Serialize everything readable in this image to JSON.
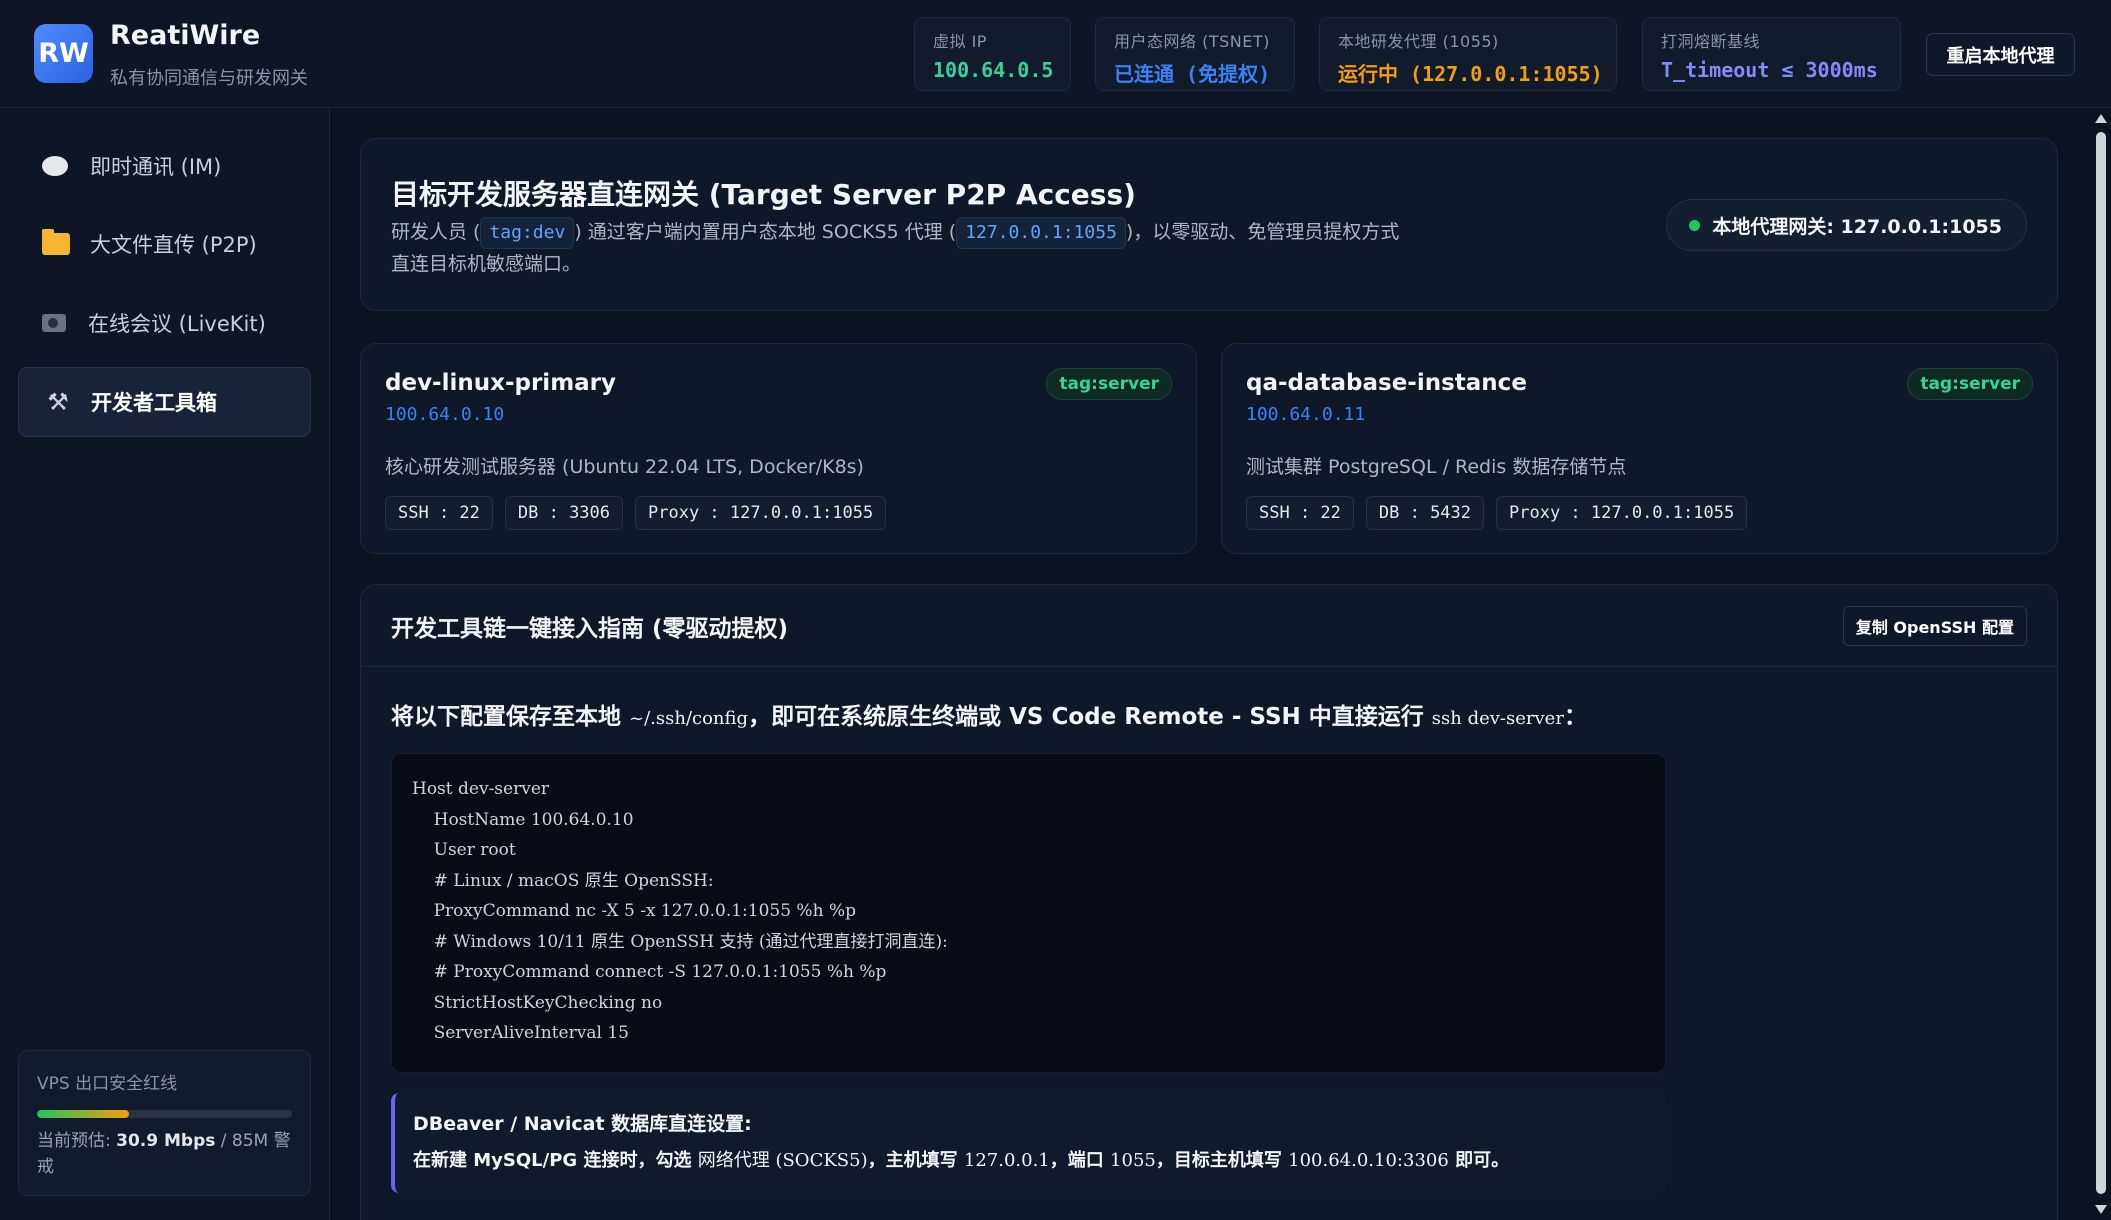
{
  "app": {
    "logo": "RW",
    "name": "ReatiWire",
    "subtitle": "私有协同通信与研发网关"
  },
  "header": {
    "stats": [
      {
        "label": "虚拟 IP",
        "value": "100.64.0.5",
        "color": "#34d399"
      },
      {
        "label": "用户态网络 (TSNET)",
        "value": "已连通 (免提权)",
        "color": "#3b82f6"
      },
      {
        "label": "本地研发代理 (1055)",
        "value": "运行中 (127.0.0.1:1055)",
        "color": "#f59e0b"
      },
      {
        "label": "打洞熔断基线",
        "value": "T_timeout ≤ 3000ms",
        "color": "#818cf8"
      }
    ],
    "restart_label": "重启本地代理"
  },
  "sidebar": {
    "items": [
      {
        "label": "即时通讯 (IM)",
        "icon": "chat-bubble-icon"
      },
      {
        "label": "大文件直传 (P2P)",
        "icon": "folder-icon"
      },
      {
        "label": "在线会议 (LiveKit)",
        "icon": "video-camera-icon"
      },
      {
        "label": "开发者工具箱",
        "icon": "tools-icon",
        "active": true
      }
    ],
    "vps": {
      "title": "VPS 出口安全红线",
      "usage_fraction": 0.36,
      "estimate_prefix": "当前预估: ",
      "estimate_value": "30.9 Mbps",
      "estimate_suffix": " / 85M 警戒"
    }
  },
  "hero": {
    "title": "目标开发服务器直连网关 (Target Server P2P Access)",
    "desc_1": "研发人员 (",
    "chip_1": "tag:dev",
    "desc_2": ") 通过客户端内置用户态本地 SOCKS5 代理 (",
    "chip_2": "127.0.0.1:1055",
    "desc_3": ")，以零驱动、免管理员提权方式直连目标机敏感端口。",
    "gateway": "本地代理网关: 127.0.0.1:1055"
  },
  "servers": [
    {
      "name": "dev-linux-primary",
      "ip": "100.64.0.10",
      "tag": "tag:server",
      "desc": "核心研发测试服务器 (Ubuntu 22.04 LTS, Docker/K8s)",
      "ports": [
        "SSH : 22",
        "DB : 3306",
        "Proxy : 127.0.0.1:1055"
      ]
    },
    {
      "name": "qa-database-instance",
      "ip": "100.64.0.11",
      "tag": "tag:server",
      "desc": "测试集群 PostgreSQL / Redis 数据存储节点",
      "ports": [
        "SSH : 22",
        "DB : 5432",
        "Proxy : 127.0.0.1:1055"
      ]
    }
  ],
  "guide": {
    "title": "开发工具链一键接入指南 (零驱动提权)",
    "copy_label": "复制 OpenSSH 配置",
    "intro_1": "将以下配置保存至本地 ",
    "intro_path": "~/.ssh/config",
    "intro_2": "，即可在系统原生终端或 VS Code Remote - SSH 中直接运行 ",
    "intro_cmd": "ssh dev-server",
    "intro_3": "：",
    "code": "Host dev-server\n    HostName 100.64.0.10\n    User root\n    # Linux / macOS 原生 OpenSSH:\n    ProxyCommand nc -X 5 -x 127.0.0.1:1055 %h %p\n    # Windows 10/11 原生 OpenSSH 支持 (通过代理直接打洞直连):\n    # ProxyCommand connect -S 127.0.0.1:1055 %h %p\n    StrictHostKeyChecking no\n    ServerAliveInterval 15",
    "db_title": "DBeaver / Navicat 数据库直连设置:",
    "db_1": "在新建 MySQL/PG 连接时，勾选 ",
    "db_proxy": "网络代理 (SOCKS5)",
    "db_2": "，主机填写 ",
    "db_host": "127.0.0.1",
    "db_3": "，端口 ",
    "db_port": "1055",
    "db_4": "，目标主机填写 ",
    "db_target": "100.64.0.10:3306",
    "db_5": " 即可。"
  }
}
